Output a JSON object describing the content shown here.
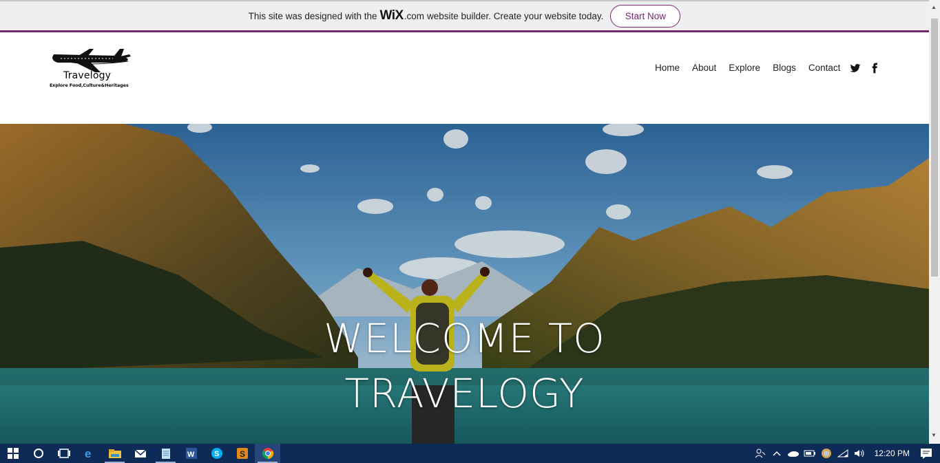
{
  "banner": {
    "text_before": "This site was designed with the",
    "wix_logo": "WiX",
    "dotcom": ".com",
    "text_after": "website builder. Create your website today.",
    "cta": "Start Now"
  },
  "site": {
    "logo_name": "Travelogy",
    "logo_tagline": "Explore Food,Culture&Heritages",
    "nav": [
      "Home",
      "About",
      "Explore",
      "Blogs",
      "Contact"
    ],
    "social": [
      "twitter-icon",
      "facebook-icon"
    ]
  },
  "hero": {
    "title_line1": "WELCOME TO",
    "title_line2": "TRAVELOGY"
  },
  "taskbar": {
    "apps": [
      "start-icon",
      "cortana-icon",
      "task-view-icon",
      "edge-icon",
      "file-explorer-icon",
      "mail-icon",
      "notepad-icon",
      "word-icon",
      "skype-icon",
      "sublime-icon",
      "chrome-icon"
    ],
    "time": "12:20 PM"
  },
  "colors": {
    "wix_accent": "#74256f",
    "taskbar": "#0d2b56"
  }
}
